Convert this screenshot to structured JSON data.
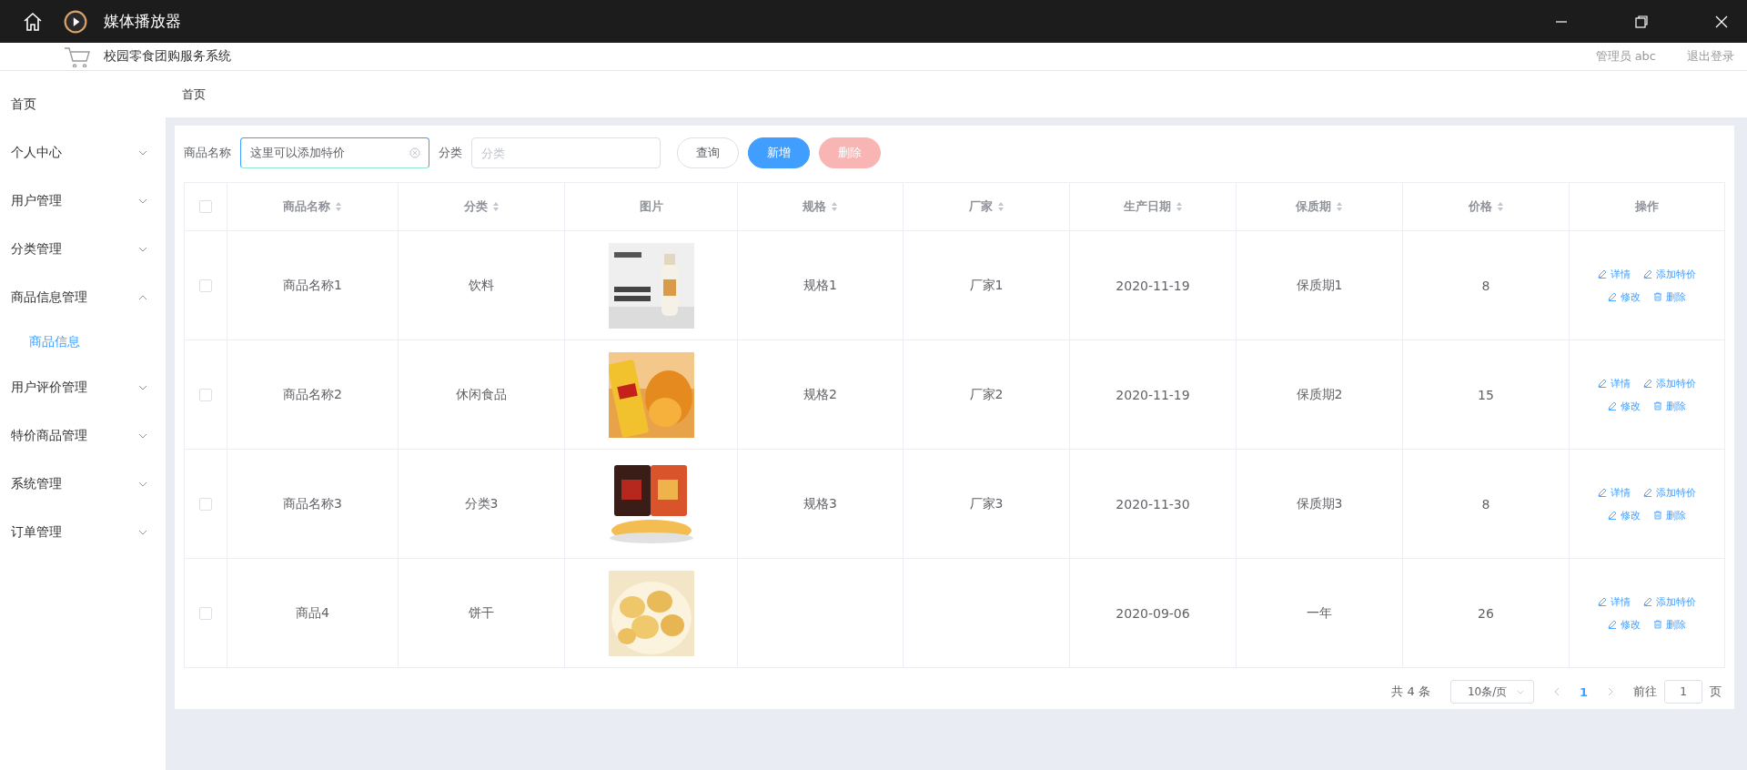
{
  "player_bar": {
    "title": "媒体播放器"
  },
  "header": {
    "title": "校园零食团购服务系统",
    "user": "管理员 abc",
    "logout": "退出登录"
  },
  "sidebar": {
    "items": [
      {
        "label": "首页",
        "kind": "link"
      },
      {
        "label": "个人中心",
        "kind": "menu",
        "expanded": false
      },
      {
        "label": "用户管理",
        "kind": "menu",
        "expanded": false
      },
      {
        "label": "分类管理",
        "kind": "menu",
        "expanded": false
      },
      {
        "label": "商品信息管理",
        "kind": "menu",
        "expanded": true,
        "children": [
          {
            "label": "商品信息",
            "selected": true
          }
        ]
      },
      {
        "label": "用户评价管理",
        "kind": "menu",
        "expanded": false
      },
      {
        "label": "特价商品管理",
        "kind": "menu",
        "expanded": false
      },
      {
        "label": "系统管理",
        "kind": "menu",
        "expanded": false
      },
      {
        "label": "订单管理",
        "kind": "menu",
        "expanded": false
      }
    ]
  },
  "breadcrumb": "首页",
  "search": {
    "name_label": "商品名称",
    "name_value": "这里可以添加特价",
    "category_label": "分类",
    "category_placeholder": "分类",
    "buttons": [
      {
        "label": "查询",
        "kind": "default",
        "disabled": false
      },
      {
        "label": "新增",
        "kind": "primary",
        "disabled": false
      },
      {
        "label": "删除",
        "kind": "danger",
        "disabled": true
      }
    ]
  },
  "table": {
    "header_checked": false,
    "columns": [
      {
        "label": "商品名称",
        "sortable": true
      },
      {
        "label": "分类",
        "sortable": true
      },
      {
        "label": "图片",
        "sortable": false
      },
      {
        "label": "规格",
        "sortable": true
      },
      {
        "label": "厂家",
        "sortable": true
      },
      {
        "label": "生产日期",
        "sortable": true
      },
      {
        "label": "保质期",
        "sortable": true
      },
      {
        "label": "价格",
        "sortable": true
      },
      {
        "label": "操作",
        "sortable": false
      }
    ],
    "rows": [
      {
        "checked": false,
        "name": "商品名称1",
        "category": "饮料",
        "spec": "规格1",
        "vendor": "厂家1",
        "date": "2020-11-19",
        "shelf": "保质期1",
        "price": "8",
        "actions": [
          "详情",
          "添加特价",
          "修改",
          "删除"
        ]
      },
      {
        "checked": false,
        "name": "商品名称2",
        "category": "休闲食品",
        "spec": "规格2",
        "vendor": "厂家2",
        "date": "2020-11-19",
        "shelf": "保质期2",
        "price": "15",
        "actions": [
          "详情",
          "添加特价",
          "修改",
          "删除"
        ]
      },
      {
        "checked": false,
        "name": "商品名称3",
        "category": "分类3",
        "spec": "规格3",
        "vendor": "厂家3",
        "date": "2020-11-30",
        "shelf": "保质期3",
        "price": "8",
        "actions": [
          "详情",
          "添加特价",
          "修改",
          "删除"
        ]
      },
      {
        "checked": false,
        "name": "商品4",
        "category": "饼干",
        "date": "2020-09-06",
        "shelf": "一年",
        "price": "26",
        "actions": [
          "详情",
          "添加特价",
          "修改",
          "删除"
        ]
      }
    ]
  },
  "pagination": {
    "total": "共 4 条",
    "page_size": "10条/页",
    "pages": [
      {
        "label": "1",
        "selected": true
      }
    ],
    "goto_label": "前往",
    "goto_value": "1",
    "page_suffix": "页"
  }
}
